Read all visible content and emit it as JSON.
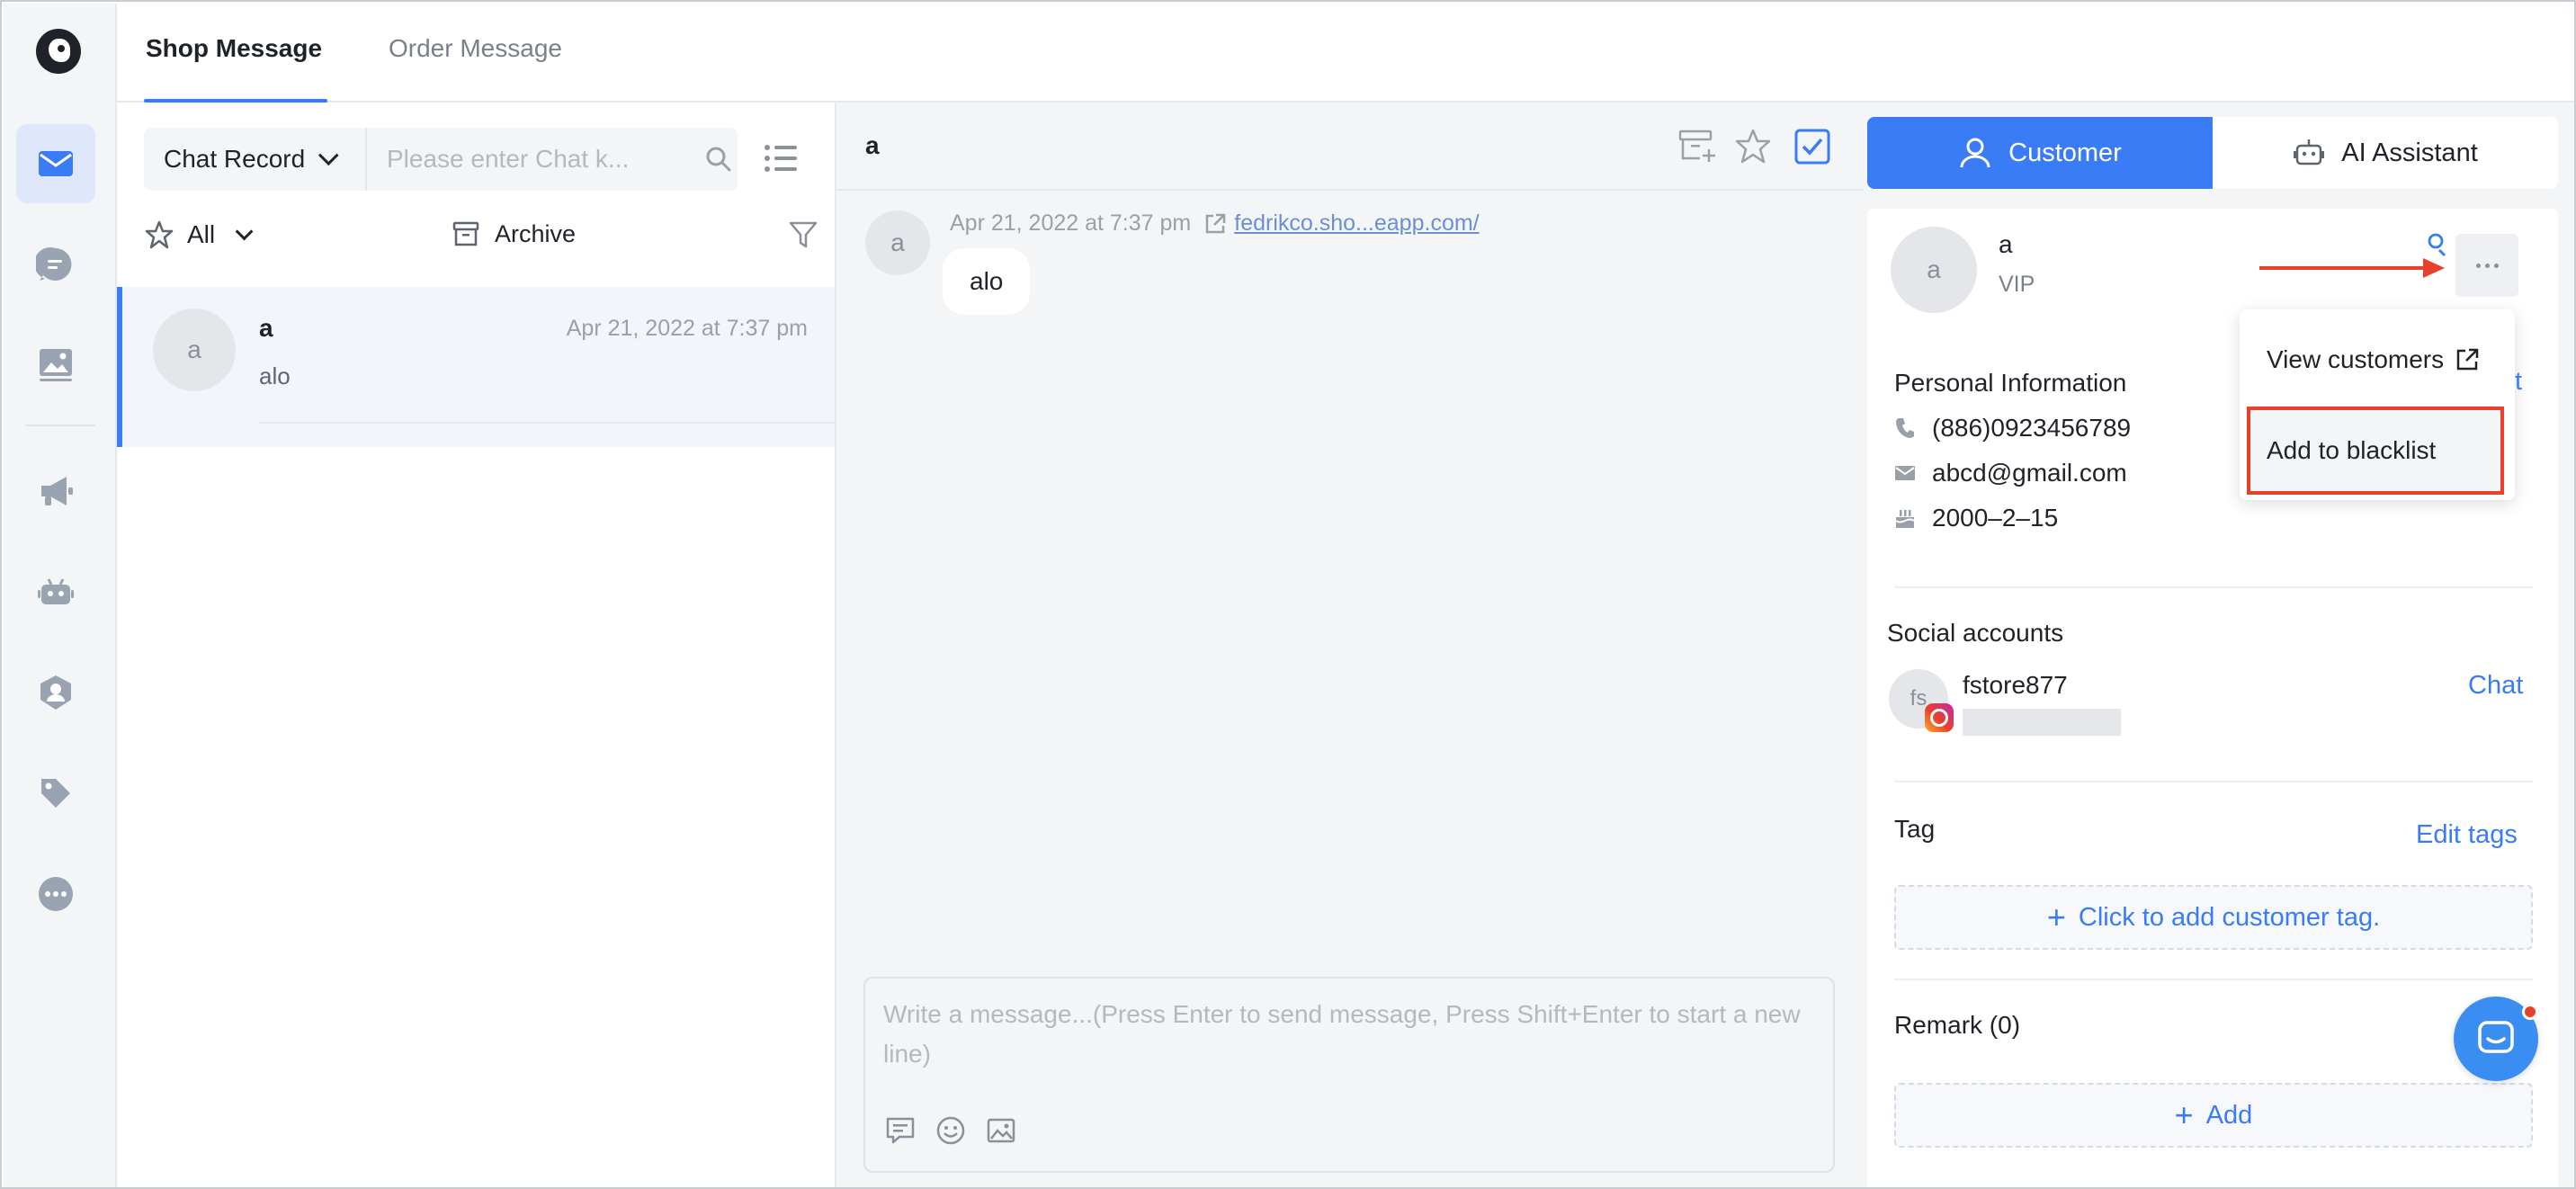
{
  "tabs": {
    "shop": "Shop Message",
    "order": "Order Message"
  },
  "list": {
    "search_select": "Chat Record",
    "search_placeholder": "Please enter Chat k...",
    "filter_all": "All",
    "archive": "Archive",
    "conversations": [
      {
        "avatar": "a",
        "name": "a",
        "time": "Apr 21, 2022 at 7:37 pm",
        "preview": "alo"
      }
    ]
  },
  "chat": {
    "title": "a",
    "message": {
      "avatar": "a",
      "time": "Apr 21, 2022 at 7:37 pm",
      "link": "fedrikco.sho...eapp.com/",
      "text": "alo"
    },
    "composer_placeholder": "Write a message...(Press Enter to send message, Press Shift+Enter to start a new line)"
  },
  "customer_panel": {
    "tab_customer": "Customer",
    "tab_ai": "AI Assistant",
    "avatar": "a",
    "name": "a",
    "level": "VIP",
    "personal_info_title": "Personal Information",
    "phone": "(886)0923456789",
    "email": "abcd@gmail.com",
    "birthday": "2000–2–15",
    "social_title": "Social accounts",
    "social_avatar": "fs",
    "social_name": "fstore877",
    "social_chat": "Chat",
    "tag_title": "Tag",
    "edit_tags": "Edit tags",
    "add_tag": "Click to add customer tag.",
    "remark_title": "Remark (0)",
    "add_remark": "Add"
  },
  "dropdown": {
    "view_customers": "View customers",
    "add_blacklist": "Add to blacklist",
    "edit_peek": "t"
  },
  "colors": {
    "accent": "#3a7bf6",
    "highlight": "#e8402a",
    "panel_bg": "#f4f5f7"
  }
}
